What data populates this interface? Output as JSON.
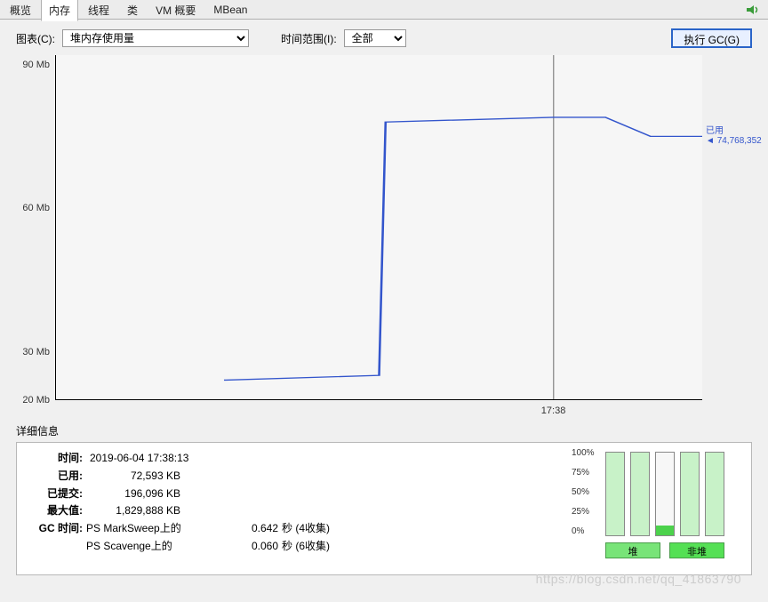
{
  "tabs": [
    "概览",
    "内存",
    "线程",
    "类",
    "VM 概要",
    "MBean"
  ],
  "active_tab": 1,
  "chart_select_label": "图表(C):",
  "chart_select_value": "堆内存使用量",
  "time_select_label": "时间范围(I):",
  "time_select_value": "全部",
  "gc_button_label": "执行 GC(G)",
  "chart_data": {
    "type": "line",
    "title": "",
    "xlabel": "",
    "ylabel": "",
    "y_ticks": [
      "90 Mb",
      "60 Mb",
      "30 Mb",
      "20 Mb"
    ],
    "y_tick_values": [
      90,
      60,
      30,
      20
    ],
    "ylim": [
      20,
      92
    ],
    "x_tick_label": "17:38",
    "x_tick_frac": 0.77,
    "series": [
      {
        "name": "已用",
        "color": "#3355cc",
        "points": [
          {
            "x": 0.26,
            "y": 24
          },
          {
            "x": 0.5,
            "y": 25
          },
          {
            "x": 0.51,
            "y": 78
          },
          {
            "x": 0.77,
            "y": 79
          },
          {
            "x": 0.85,
            "y": 79
          },
          {
            "x": 0.92,
            "y": 75
          },
          {
            "x": 1.0,
            "y": 75
          }
        ]
      }
    ],
    "end_marker": {
      "label_top": "已用",
      "label_bottom": "74,768,352"
    }
  },
  "details_title": "详细信息",
  "details": {
    "time_key": "时间:",
    "time_val": "2019-06-04 17:38:13",
    "used_key": "已用:",
    "used_val": "72,593 KB",
    "committed_key": "已提交:",
    "committed_val": "196,096 KB",
    "max_key": "最大值:",
    "max_val": "1,829,888 KB",
    "gc_key": "GC 时间:",
    "gc_rows": [
      {
        "src": "PS MarkSweep上的",
        "sec": "0.642",
        "unit": "秒 (4收集)"
      },
      {
        "src": "PS Scavenge上的",
        "sec": "0.060",
        "unit": "秒 (6收集)"
      }
    ]
  },
  "pct_ticks": [
    "100%",
    "75%",
    "50%",
    "25%",
    "0%"
  ],
  "pools": [
    {
      "pct": 100,
      "light": true
    },
    {
      "pct": 100,
      "light": true
    },
    {
      "pct": 12,
      "light": false
    },
    {
      "pct": 100,
      "light": true
    },
    {
      "pct": 100,
      "light": true
    }
  ],
  "pool_buttons": [
    "堆",
    "非堆"
  ],
  "watermark": "https://blog.csdn.net/qq_41863790"
}
